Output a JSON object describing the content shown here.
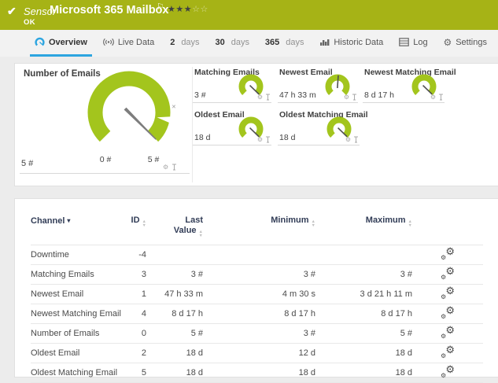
{
  "header": {
    "kind_label": "Sensor",
    "title": "Microsoft 365 Mailbox",
    "status_text": "OK",
    "rating_filled": 3,
    "rating_total": 5
  },
  "tabs": {
    "overview": "Overview",
    "live_data": "Live Data",
    "d2_num": "2",
    "d2_word": "days",
    "d30_num": "30",
    "d30_word": "days",
    "d365_num": "365",
    "d365_word": "days",
    "historic": "Historic Data",
    "log": "Log",
    "settings": "Settings"
  },
  "gauges": {
    "main": {
      "title": "Number of Emails",
      "value": "5 #",
      "scale_min_label": "0 #",
      "scale_max_label": "5 #",
      "needle_deg": 135
    },
    "small": [
      {
        "title": "Matching Emails",
        "value": "3 #",
        "needle_deg": 134
      },
      {
        "title": "Newest Email",
        "value": "47 h 33 m",
        "needle_deg": 4
      },
      {
        "title": "Newest Matching Email",
        "value": "8 d 17 h",
        "needle_deg": 134
      },
      {
        "title": "Oldest Email",
        "value": "18 d",
        "needle_deg": 134
      },
      {
        "title": "Oldest Matching Email",
        "value": "18 d",
        "needle_deg": 134
      }
    ]
  },
  "table": {
    "headers": {
      "channel": "Channel",
      "id": "ID",
      "last_line1": "Last",
      "last_line2": "Value",
      "minimum": "Minimum",
      "maximum": "Maximum"
    },
    "rows": [
      {
        "channel": "Downtime",
        "id": "-4",
        "last": "",
        "min": "",
        "max": ""
      },
      {
        "channel": "Matching Emails",
        "id": "3",
        "last": "3 #",
        "min": "3 #",
        "max": "3 #"
      },
      {
        "channel": "Newest Email",
        "id": "1",
        "last": "47 h 33 m",
        "min": "4 m 30 s",
        "max": "3 d 21 h 11 m"
      },
      {
        "channel": "Newest Matching Email",
        "id": "4",
        "last": "8 d 17 h",
        "min": "8 d 17 h",
        "max": "8 d 17 h"
      },
      {
        "channel": "Number of Emails",
        "id": "0",
        "last": "5 #",
        "min": "3 #",
        "max": "5 #"
      },
      {
        "channel": "Oldest Email",
        "id": "2",
        "last": "18 d",
        "min": "12 d",
        "max": "18 d"
      },
      {
        "channel": "Oldest Matching Email",
        "id": "5",
        "last": "18 d",
        "min": "18 d",
        "max": "18 d"
      }
    ]
  },
  "icons": {
    "check": "✔",
    "flag": "⚐",
    "star_filled": "★",
    "star_empty": "☆",
    "gear": "⚙",
    "sort_caret": "▾",
    "sort_up": "▲",
    "sort_down": "▼",
    "peak_marker": "✕"
  },
  "colors": {
    "status_green": "#a6b316",
    "gauge_green": "#a3c51d",
    "accent_blue": "#2da5e0"
  }
}
